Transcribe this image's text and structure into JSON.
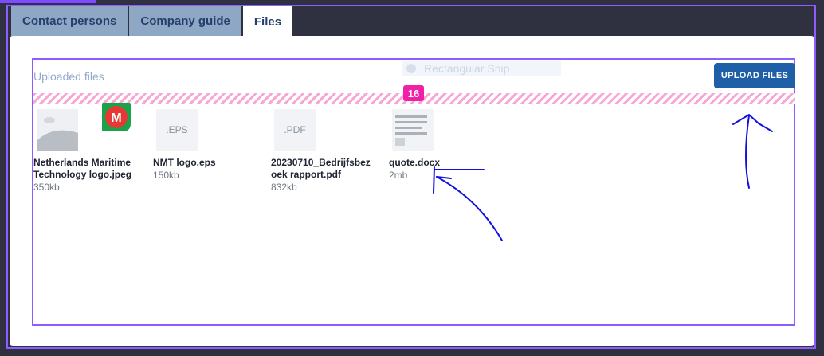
{
  "tabs": [
    {
      "label": "Contact persons"
    },
    {
      "label": "Company guide"
    },
    {
      "label": "Files",
      "active": true
    }
  ],
  "section": {
    "title": "Uploaded files",
    "upload_label": "UPLOAD FILES",
    "snip_overlay": "Rectangular Snip",
    "badge_count": "16"
  },
  "avatar": {
    "letter": "M",
    "color": "#e53935",
    "ring": "#1aa34a"
  },
  "files": [
    {
      "name": "Netherlands Maritime Technology logo.jpeg",
      "size": "350kb",
      "thumb": "image-icon"
    },
    {
      "name": "NMT logo.eps",
      "size": "150kb",
      "thumb_label": ".EPS"
    },
    {
      "name": "20230710_Bedrijfsbezoek rapport.pdf",
      "size": "832kb",
      "thumb_label": ".PDF"
    },
    {
      "name": "quote.docx",
      "size": "2mb",
      "thumb": "document-icon"
    }
  ],
  "colors": {
    "accent": "#8f5cff",
    "button": "#1f5fa8",
    "badge": "#f020a8",
    "annotation": "#1010e0"
  }
}
